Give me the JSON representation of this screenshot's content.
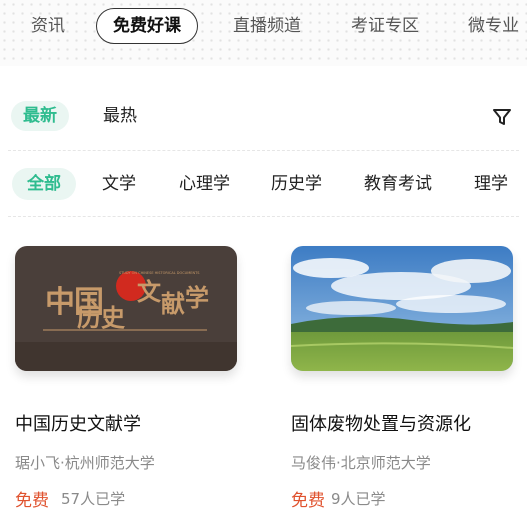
{
  "top_tabs": [
    {
      "label": "资讯"
    },
    {
      "label": "免费好课",
      "active": true
    },
    {
      "label": "直播频道"
    },
    {
      "label": "考证专区"
    },
    {
      "label": "微专业"
    }
  ],
  "sort": {
    "options": [
      {
        "label": "最新",
        "active": true
      },
      {
        "label": "最热"
      }
    ],
    "filter_icon": "filter-icon"
  },
  "categories": [
    {
      "label": "全部",
      "active": true
    },
    {
      "label": "文学"
    },
    {
      "label": "心理学"
    },
    {
      "label": "历史学"
    },
    {
      "label": "教育考试"
    },
    {
      "label": "理学"
    }
  ],
  "courses": [
    {
      "title": "中国历史文献学",
      "teacher": "琚小飞·杭州师范大学",
      "price": "免费",
      "learners": "57人已学",
      "cover_title": "中国历史文献学",
      "cover_subtitle": "STUDY ON CHINESE HISTORICAL DOCUMENTS",
      "cover_bg": "#4a3f3a",
      "cover_accent": "#d12a1f",
      "cover_text_color": "#c79a6a"
    },
    {
      "title": "固体废物处置与资源化",
      "teacher": "马俊伟·北京师范大学",
      "price": "免费",
      "learners": "9人已学"
    }
  ],
  "colors": {
    "accent": "#2fbc8f",
    "accent_bg": "#eaf6f2",
    "price": "#e0532f",
    "muted": "#8a8a8a"
  }
}
